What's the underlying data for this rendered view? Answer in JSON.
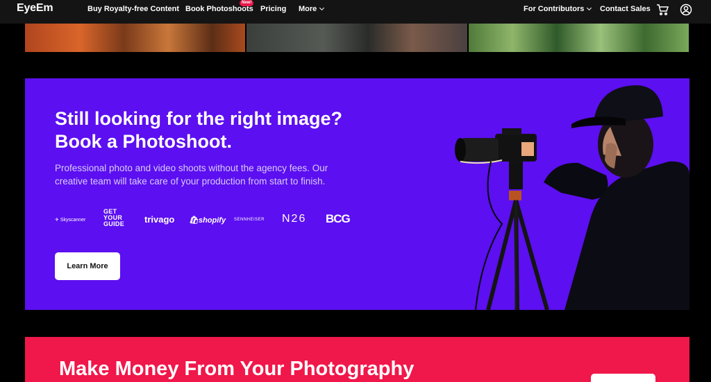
{
  "nav": {
    "logo": "EyeEm",
    "links": [
      {
        "label": "Buy Royalty-free Content"
      },
      {
        "label": "Book Photoshoots",
        "badge": "New!"
      },
      {
        "label": "Pricing"
      },
      {
        "label": "More"
      }
    ],
    "contributors": "For Contributors",
    "contact": "Contact Sales",
    "icons": {
      "cart": "cart-icon",
      "account": "user-circle-icon",
      "chevron": "chevron-down-icon"
    }
  },
  "promo": {
    "headline_1": "Still looking for the right image?",
    "headline_2": "Book a Photoshoot.",
    "description": "Professional photo and video shoots without the agency fees. Our creative team will take care of your production from start to finish.",
    "clients": [
      "Skyscanner",
      "GET YOUR GUIDE",
      "trivago",
      "shopify",
      "SENNHEISER",
      "N26",
      "BCG"
    ],
    "cta": "Learn More",
    "background": "#5c0ff0"
  },
  "money": {
    "headline": "Make Money From Your Photography",
    "background": "#f0174a"
  }
}
